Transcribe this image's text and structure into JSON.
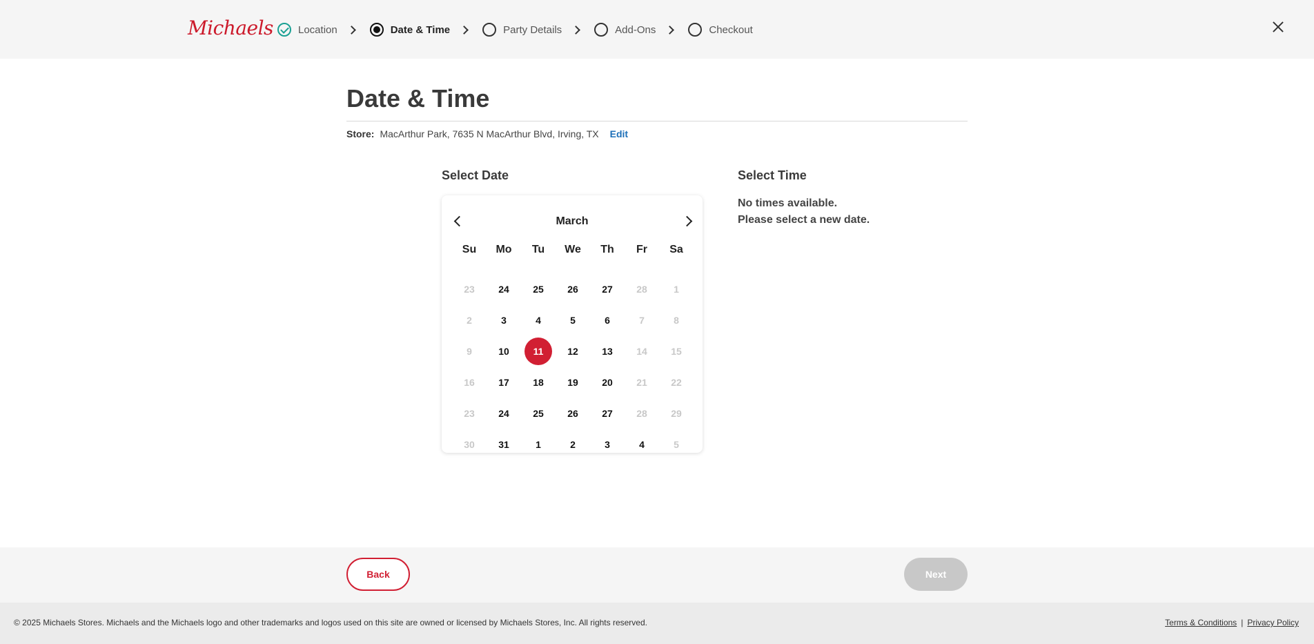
{
  "header": {
    "logo": "Michaels",
    "steps": [
      {
        "label": "Location"
      },
      {
        "label": "Date & Time"
      },
      {
        "label": "Party Details"
      },
      {
        "label": "Add-Ons"
      },
      {
        "label": "Checkout"
      }
    ]
  },
  "main": {
    "title": "Date & Time",
    "store_label": "Store:",
    "store_value": "MacArthur Park, 7635 N MacArthur Blvd, Irving, TX",
    "edit_label": "Edit",
    "select_date_title": "Select Date",
    "select_time_title": "Select Time",
    "no_times_line1": "No times available.",
    "no_times_line2": "Please select a new date."
  },
  "calendar": {
    "month": "March",
    "weekdays": [
      "Su",
      "Mo",
      "Tu",
      "We",
      "Th",
      "Fr",
      "Sa"
    ],
    "selected": "11",
    "weeks": [
      [
        {
          "d": "23",
          "off": true
        },
        {
          "d": "24",
          "off": false
        },
        {
          "d": "25",
          "off": false
        },
        {
          "d": "26",
          "off": false
        },
        {
          "d": "27",
          "off": false
        },
        {
          "d": "28",
          "off": true
        },
        {
          "d": "1",
          "off": true
        }
      ],
      [
        {
          "d": "2",
          "off": true
        },
        {
          "d": "3",
          "off": false
        },
        {
          "d": "4",
          "off": false
        },
        {
          "d": "5",
          "off": false
        },
        {
          "d": "6",
          "off": false
        },
        {
          "d": "7",
          "off": true
        },
        {
          "d": "8",
          "off": true
        }
      ],
      [
        {
          "d": "9",
          "off": true
        },
        {
          "d": "10",
          "off": false
        },
        {
          "d": "11",
          "off": false,
          "sel": true
        },
        {
          "d": "12",
          "off": false
        },
        {
          "d": "13",
          "off": false
        },
        {
          "d": "14",
          "off": true
        },
        {
          "d": "15",
          "off": true
        }
      ],
      [
        {
          "d": "16",
          "off": true
        },
        {
          "d": "17",
          "off": false
        },
        {
          "d": "18",
          "off": false
        },
        {
          "d": "19",
          "off": false
        },
        {
          "d": "20",
          "off": false
        },
        {
          "d": "21",
          "off": true
        },
        {
          "d": "22",
          "off": true
        }
      ],
      [
        {
          "d": "23",
          "off": true
        },
        {
          "d": "24",
          "off": false
        },
        {
          "d": "25",
          "off": false
        },
        {
          "d": "26",
          "off": false
        },
        {
          "d": "27",
          "off": false
        },
        {
          "d": "28",
          "off": true
        },
        {
          "d": "29",
          "off": true
        }
      ],
      [
        {
          "d": "30",
          "off": true
        },
        {
          "d": "31",
          "off": false
        },
        {
          "d": "1",
          "off": false
        },
        {
          "d": "2",
          "off": false
        },
        {
          "d": "3",
          "off": false
        },
        {
          "d": "4",
          "off": false
        },
        {
          "d": "5",
          "off": true
        }
      ]
    ]
  },
  "actions": {
    "back_label": "Back",
    "next_label": "Next"
  },
  "footer": {
    "copyright": "© 2025 Michaels Stores. Michaels and the Michaels logo and other trademarks and logos used on this site are owned or licensed by Michaels Stores, Inc. All rights reserved.",
    "terms": "Terms & Conditions",
    "separator": "|",
    "privacy": "Privacy Policy"
  },
  "colors": {
    "brand_red": "#d11f33",
    "done_teal": "#19a093",
    "link_blue": "#1c6fb8"
  }
}
